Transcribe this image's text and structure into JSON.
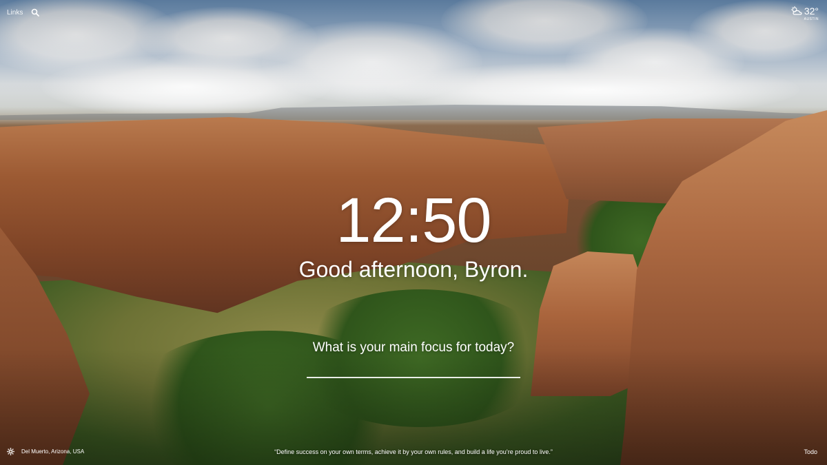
{
  "header": {
    "links_label": "Links",
    "search_icon": "search-icon"
  },
  "weather": {
    "icon": "partly-cloudy-icon",
    "temperature": "32°",
    "location": "AUSTIN"
  },
  "center": {
    "time": "12:50",
    "greeting": "Good afternoon, Byron.",
    "focus_question": "What is your main focus for today?",
    "focus_value": ""
  },
  "footer": {
    "settings_icon": "gear-icon",
    "photo_location": "Del Muerto, Arizona, USA",
    "quote": "“Define success on your own terms, achieve it by your own rules, and build a life you’re proud to live.”",
    "todo_label": "Todo"
  },
  "colors": {
    "text": "#ffffff",
    "sky": "#6e95bf",
    "rock": "#a9643c",
    "vegetation": "#3f6a24"
  }
}
